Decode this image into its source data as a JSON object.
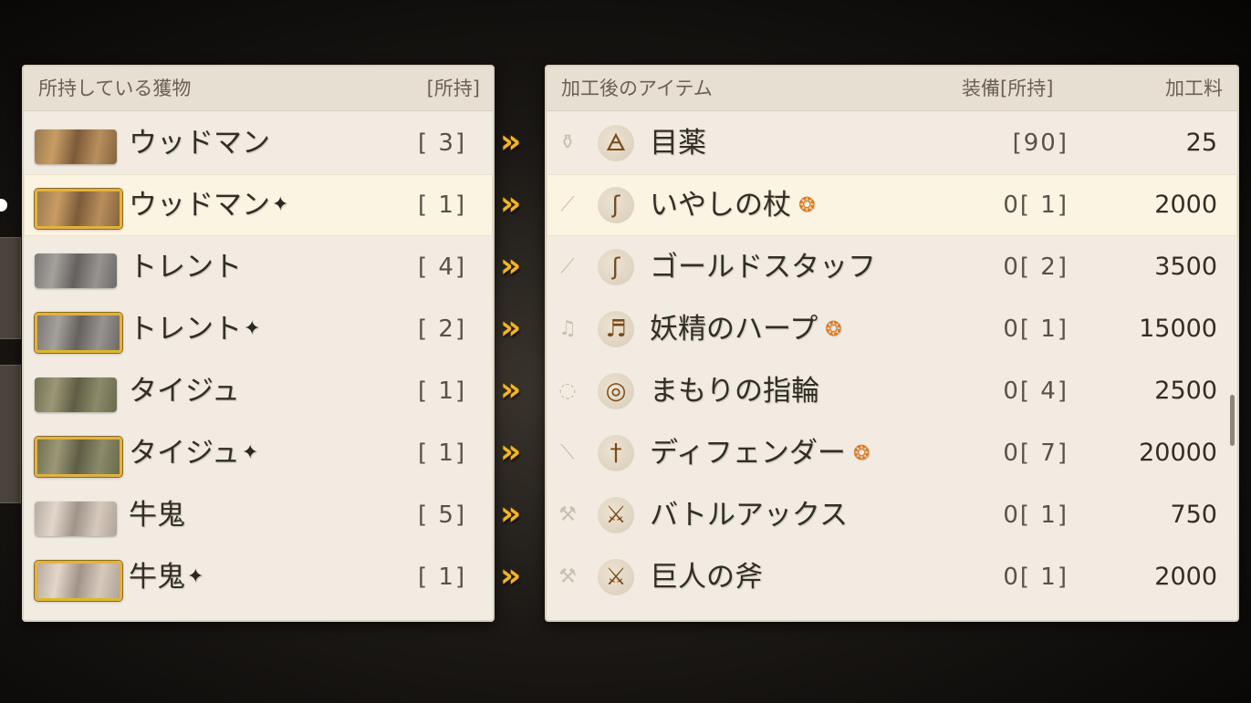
{
  "left_panel": {
    "header_title": "所持している獲物",
    "header_count": "[所持]",
    "rows": [
      {
        "name": "ウッドマン",
        "sparkle": "",
        "count": "[ 3]",
        "thumb": "wood",
        "gold": false,
        "selected": false
      },
      {
        "name": "ウッドマン",
        "sparkle": "✦",
        "count": "[ 1]",
        "thumb": "wood",
        "gold": true,
        "selected": true
      },
      {
        "name": "トレント",
        "sparkle": "",
        "count": "[ 4]",
        "thumb": "grey",
        "gold": false,
        "selected": false
      },
      {
        "name": "トレント",
        "sparkle": "✦",
        "count": "[ 2]",
        "thumb": "grey",
        "gold": true,
        "selected": false
      },
      {
        "name": "タイジュ",
        "sparkle": "",
        "count": "[ 1]",
        "thumb": "olive",
        "gold": false,
        "selected": false
      },
      {
        "name": "タイジュ",
        "sparkle": "✦",
        "count": "[ 1]",
        "thumb": "olive",
        "gold": true,
        "selected": false
      },
      {
        "name": "牛鬼",
        "sparkle": "",
        "count": "[ 5]",
        "thumb": "pale",
        "gold": false,
        "selected": false
      },
      {
        "name": "牛鬼",
        "sparkle": "✦",
        "count": "[ 1]",
        "thumb": "pale",
        "gold": true,
        "selected": false
      }
    ]
  },
  "arrow_glyph": "»",
  "right_panel": {
    "header_title": "加工後のアイテム",
    "header_equip": "装備[所持]",
    "header_price": "加工料",
    "rows": [
      {
        "category_icon": "potion-category-icon",
        "category_glyph": "⚱",
        "item_icon": "potion-icon",
        "item_glyph": "🜁",
        "name": "目薬",
        "recommended": false,
        "equip": "[90]",
        "price": "25",
        "selected": false
      },
      {
        "category_icon": "staff-category-icon",
        "category_glyph": "⟋",
        "item_icon": "healing-staff-icon",
        "item_glyph": "ʃ",
        "name": "いやしの杖",
        "recommended": true,
        "equip": "0[ 1]",
        "price": "2000",
        "selected": true
      },
      {
        "category_icon": "staff-category-icon",
        "category_glyph": "⟋",
        "item_icon": "gold-staff-icon",
        "item_glyph": "ʃ",
        "name": "ゴールドスタッフ",
        "recommended": false,
        "equip": "0[ 2]",
        "price": "3500",
        "selected": false
      },
      {
        "category_icon": "harp-category-icon",
        "category_glyph": "♫",
        "item_icon": "harp-icon",
        "item_glyph": "♬",
        "name": "妖精のハープ",
        "recommended": true,
        "equip": "0[ 1]",
        "price": "15000",
        "selected": false
      },
      {
        "category_icon": "ring-category-icon",
        "category_glyph": "◌",
        "item_icon": "ring-icon",
        "item_glyph": "◎",
        "name": "まもりの指輪",
        "recommended": false,
        "equip": "0[ 4]",
        "price": "2500",
        "selected": false
      },
      {
        "category_icon": "sword-category-icon",
        "category_glyph": "⟍",
        "item_icon": "sword-icon",
        "item_glyph": "†",
        "name": "ディフェンダー",
        "recommended": true,
        "equip": "0[ 7]",
        "price": "20000",
        "selected": false
      },
      {
        "category_icon": "axe-category-icon",
        "category_glyph": "⚒",
        "item_icon": "battle-axe-icon",
        "item_glyph": "⚔",
        "name": "バトルアックス",
        "recommended": false,
        "equip": "0[ 1]",
        "price": "750",
        "selected": false
      },
      {
        "category_icon": "axe-category-icon",
        "category_glyph": "⚒",
        "item_icon": "giant-axe-icon",
        "item_glyph": "⚔",
        "name": "巨人の斧",
        "recommended": false,
        "equip": "0[ 1]",
        "price": "2000",
        "selected": false
      }
    ],
    "recommended_glyph": "❂"
  }
}
